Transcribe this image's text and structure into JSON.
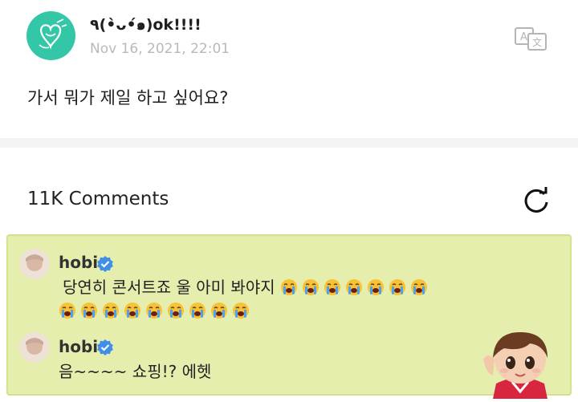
{
  "post": {
    "author": "٩(•̀ᴗ•́๑)ok!!!!",
    "date": "Nov 16, 2021, 22:01",
    "text": "가서 뭐가 제일 하고 싶어요?"
  },
  "comments_section": {
    "title": "11K Comments"
  },
  "comments": [
    {
      "name": "hobi",
      "text_line1": "당연히 콘서트죠 울 아미 봐야지",
      "emoji": "loudly-crying-face",
      "emoji_count_line1": 7,
      "emoji_count_line2": 9
    },
    {
      "name": "hobi",
      "text": "음~~~~ 쇼핑!? 에헷"
    }
  ],
  "icons": {
    "translate": "translate-icon",
    "refresh": "refresh-icon",
    "verified": "verified-badge-icon"
  },
  "colors": {
    "highlight_bg": "#e6eeae",
    "verified": "#3f8fe8",
    "avatar_bg": "#33c7a8"
  }
}
